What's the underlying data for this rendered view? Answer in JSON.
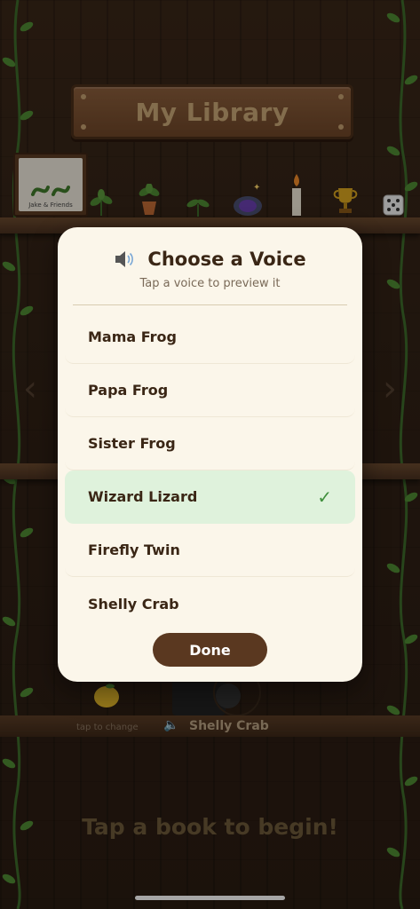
{
  "library": {
    "title": "My Library",
    "book_label": "Jake & Friends",
    "begin_prompt": "Tap a book to begin!"
  },
  "status_bar": {
    "tap_to_change": "tap to change",
    "current_voice": "Shelly Crab"
  },
  "modal": {
    "title": "Choose a Voice",
    "subtitle": "Tap a voice to preview it",
    "voices": [
      {
        "label": "Mama Frog",
        "selected": false
      },
      {
        "label": "Papa Frog",
        "selected": false
      },
      {
        "label": "Sister Frog",
        "selected": false
      },
      {
        "label": "Wizard Lizard",
        "selected": true
      },
      {
        "label": "Firefly Twin",
        "selected": false
      },
      {
        "label": "Shelly Crab",
        "selected": false
      }
    ],
    "done_label": "Done",
    "check_mark": "✓"
  },
  "icons": {
    "speaker": "speaker-icon",
    "arrow_left": "chevron-left-icon",
    "arrow_right": "chevron-right-icon",
    "check": "check-icon"
  },
  "colors": {
    "modal_bg": "#fbf6ea",
    "selected_row": "#dff2dc",
    "check": "#3f8f3c",
    "done_button": "#5a3820",
    "title_text": "#3a2615"
  }
}
